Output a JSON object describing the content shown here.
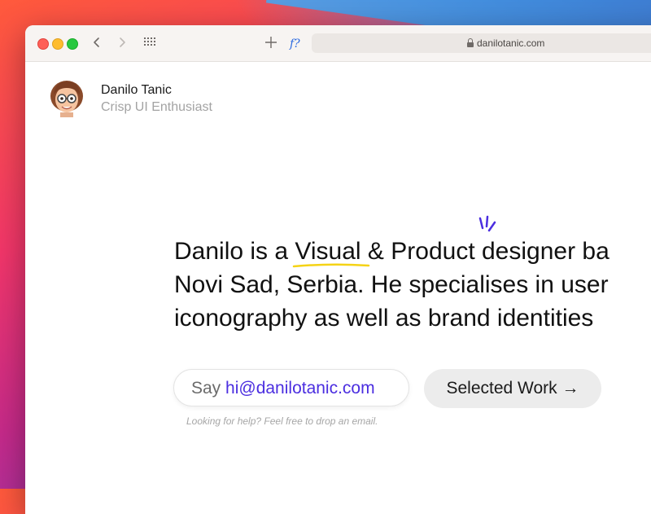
{
  "browser": {
    "url": "danilotanic.com",
    "back_icon": "chevron-left-icon",
    "forward_icon": "chevron-right-icon",
    "new_tab_icon": "plus-icon",
    "extension_label": "f?"
  },
  "profile": {
    "name": "Danilo Tanic",
    "role": "Crisp UI Enthusiast"
  },
  "hero": {
    "line1_pre": "Danilo is a ",
    "line1_visual": "Visual",
    "line1_mid": " & ",
    "line1_product": "Product",
    "line1_post": " designer ba",
    "line2": "Novi Sad, Serbia. He specialises in user",
    "line3": "iconography as well as brand identities"
  },
  "cta": {
    "email_prefix": "Say ",
    "email": "hi@danilotanic.com",
    "work_label": "Selected Work →",
    "help_text": "Looking for help? Feel free to drop an email."
  },
  "colors": {
    "accent": "#4b2ee0",
    "highlight": "#f5d316",
    "traffic_red": "#fe5f57",
    "traffic_yellow": "#febc2e",
    "traffic_green": "#28c840"
  }
}
